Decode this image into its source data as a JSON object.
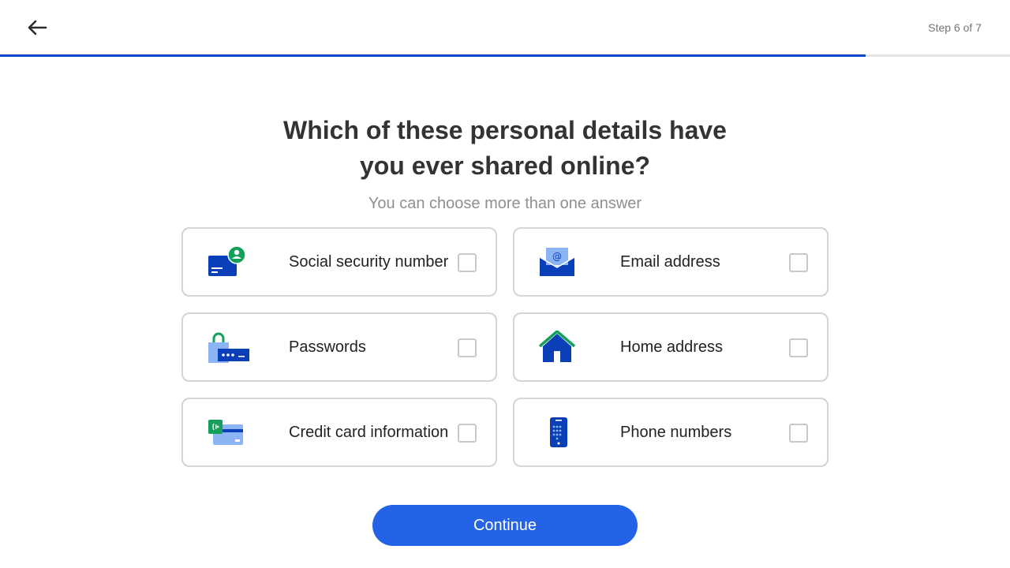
{
  "header": {
    "step_label": "Step 6 of 7",
    "progress": 0.857
  },
  "question": {
    "title_line1": "Which of these personal details have",
    "title_line2": "you ever shared online?",
    "subtitle": "You can choose more than one answer"
  },
  "options": [
    {
      "label": "Social security number",
      "icon": "id-card-icon",
      "checked": false
    },
    {
      "label": "Email address",
      "icon": "envelope-icon",
      "checked": false
    },
    {
      "label": "Passwords",
      "icon": "password-lock-icon",
      "checked": false
    },
    {
      "label": "Home address",
      "icon": "house-icon",
      "checked": false
    },
    {
      "label": "Credit card information",
      "icon": "credit-card-icon",
      "checked": false
    },
    {
      "label": "Phone numbers",
      "icon": "phone-icon",
      "checked": false
    }
  ],
  "continue_label": "Continue",
  "colors": {
    "accent": "#2563e6",
    "progress": "#0d47c9",
    "icon_blue": "#0a3fb8",
    "icon_light_blue": "#8cb4f5",
    "icon_green": "#14a05a"
  }
}
